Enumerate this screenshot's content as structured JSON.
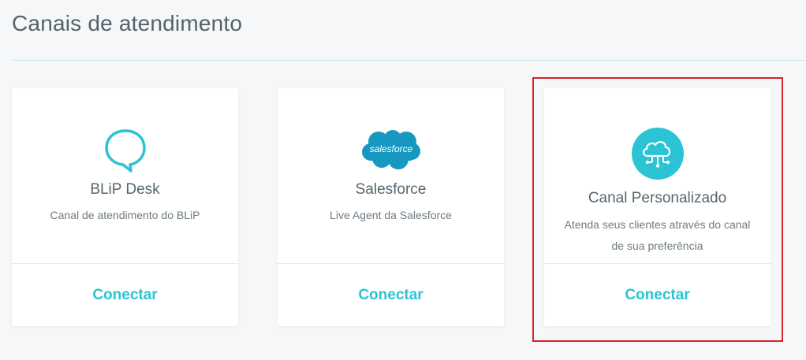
{
  "page": {
    "title": "Canais de atendimento"
  },
  "cards": [
    {
      "title": "BLiP Desk",
      "description": "Canal de atendimento do BLiP",
      "action_label": "Conectar",
      "icon": "chat-bubble-icon"
    },
    {
      "title": "Salesforce",
      "description": "Live Agent da Salesforce",
      "action_label": "Conectar",
      "icon": "salesforce-logo",
      "logo_text": "salesforce"
    },
    {
      "title": "Canal Personalizado",
      "description": "Atenda seus clientes através do canal de sua preferência",
      "action_label": "Conectar",
      "icon": "cloud-network-icon"
    }
  ],
  "colors": {
    "accent": "#2cc3d5",
    "salesforce_blue": "#1798c1",
    "highlight": "#d9202b",
    "background": "#f5f7f8"
  }
}
